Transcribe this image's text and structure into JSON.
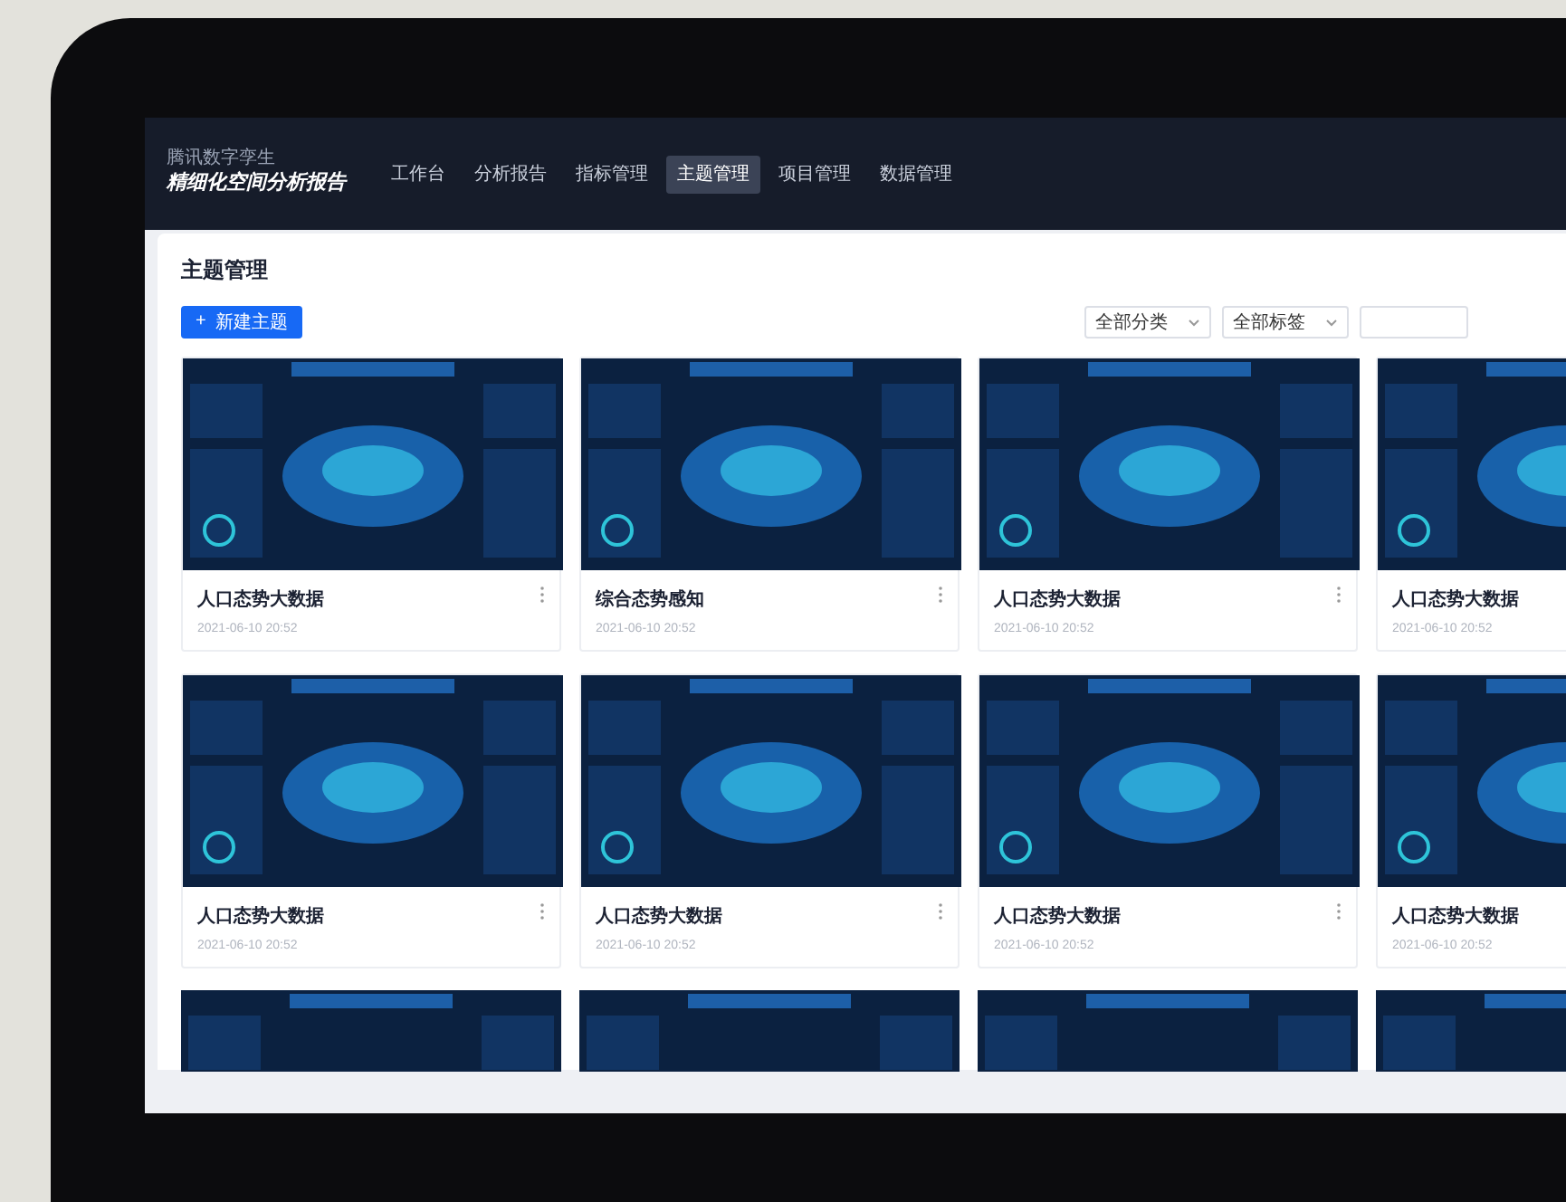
{
  "brand": {
    "subtitle": "腾讯数字孪生",
    "title": "精细化空间分析报告"
  },
  "nav": [
    {
      "label": "工作台",
      "selected": false
    },
    {
      "label": "分析报告",
      "selected": false
    },
    {
      "label": "指标管理",
      "selected": false
    },
    {
      "label": "主题管理",
      "selected": true
    },
    {
      "label": "项目管理",
      "selected": false
    },
    {
      "label": "数据管理",
      "selected": false
    }
  ],
  "page_title": "主题管理",
  "new_button": {
    "icon": "+",
    "label": "新建主题"
  },
  "filters": [
    "全部分类",
    "全部标签"
  ],
  "rows": [
    [
      {
        "kind": "card",
        "title": "人口态势大数据",
        "date": "2021-06-10 20:52"
      },
      {
        "kind": "card",
        "title": "综合态势感知",
        "date": "2021-06-10 20:52"
      },
      {
        "kind": "card",
        "title": "人口态势大数据",
        "date": "2021-06-10 20:52"
      },
      {
        "kind": "card",
        "title": "人口态势大数据",
        "date": "2021-06-10 20:52"
      }
    ],
    [
      {
        "kind": "card",
        "title": "人口态势大数据",
        "date": "2021-06-10 20:52"
      },
      {
        "kind": "card",
        "title": "人口态势大数据",
        "date": "2021-06-10 20:52"
      },
      {
        "kind": "card",
        "title": "人口态势大数据",
        "date": "2021-06-10 20:52"
      },
      {
        "kind": "card",
        "title": "人口态势大数据",
        "date": "2021-06-10 20:52"
      }
    ],
    [
      {
        "kind": "preview"
      },
      {
        "kind": "preview"
      },
      {
        "kind": "preview"
      },
      {
        "kind": "preview"
      }
    ]
  ]
}
